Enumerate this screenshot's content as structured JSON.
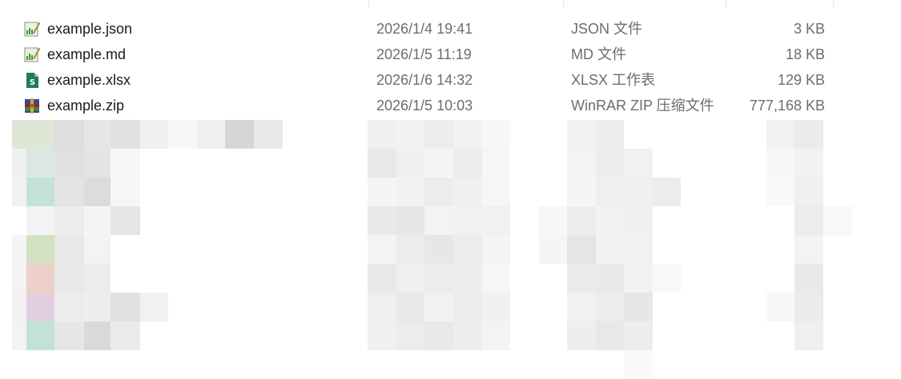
{
  "files": [
    {
      "name": "example.json",
      "modified": "2026/1/4 19:41",
      "type": "JSON 文件",
      "size": "3 KB",
      "icon": "json-file-icon"
    },
    {
      "name": "example.md",
      "modified": "2026/1/5 11:19",
      "type": "MD 文件",
      "size": "18 KB",
      "icon": "md-file-icon"
    },
    {
      "name": "example.xlsx",
      "modified": "2026/1/6 14:32",
      "type": "XLSX 工作表",
      "size": "129 KB",
      "icon": "xlsx-file-icon"
    },
    {
      "name": "example.zip",
      "modified": "2026/1/5 10:03",
      "type": "WinRAR ZIP 压缩文件",
      "size": "777,168 KB",
      "icon": "winrar-zip-icon"
    }
  ],
  "colors": {
    "accent_green": "#3f9b3a",
    "xlsx_green": "#1f7f4f",
    "secondary_text": "#6d6d6d"
  }
}
